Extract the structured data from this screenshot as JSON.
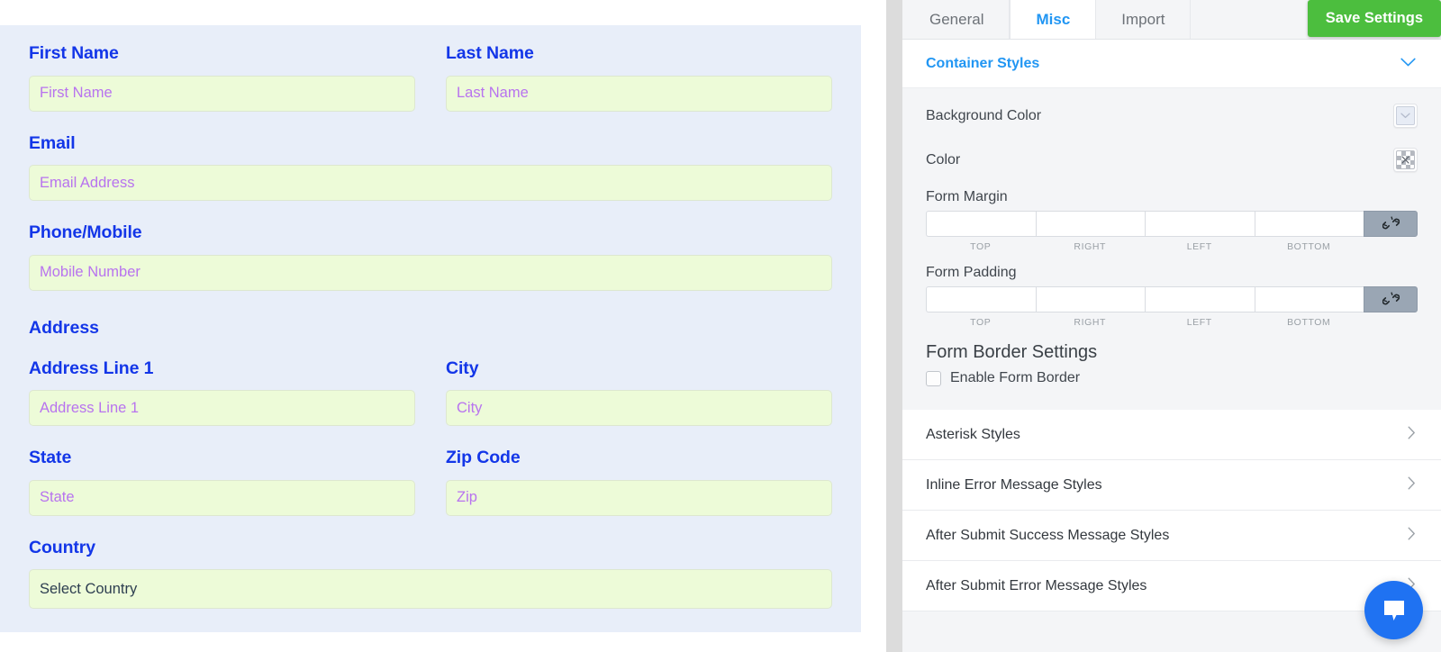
{
  "form_preview": {
    "fields": [
      {
        "label": "First Name",
        "placeholder": "First Name"
      },
      {
        "label": "Last Name",
        "placeholder": "Last Name"
      },
      {
        "label": "Email",
        "placeholder": "Email Address"
      },
      {
        "label": "Phone/Mobile",
        "placeholder": "Mobile Number"
      }
    ],
    "address_group_heading": "Address",
    "address_fields": [
      {
        "label": "Address Line 1",
        "placeholder": "Address Line 1"
      },
      {
        "label": "City",
        "placeholder": "City"
      },
      {
        "label": "State",
        "placeholder": "State"
      },
      {
        "label": "Zip Code",
        "placeholder": "Zip"
      }
    ],
    "country": {
      "label": "Country",
      "selected": "Select Country"
    },
    "colors": {
      "card_background": "#e8eef9",
      "label_color": "#1336e8",
      "input_background": "#edfbd8",
      "placeholder_color": "#b873ef"
    }
  },
  "settings": {
    "tabs": [
      {
        "label": "General",
        "active": false
      },
      {
        "label": "Misc",
        "active": true
      },
      {
        "label": "Import",
        "active": false
      }
    ],
    "save_button": "Save Settings",
    "save_button_color": "#4cbe3e",
    "accent_color": "#2196f3",
    "container_styles": {
      "title": "Container Styles",
      "chevron": "chevron-down",
      "options": [
        {
          "label": "Background Color",
          "swatch": "light-blue"
        },
        {
          "label": "Color",
          "swatch": "transparent-checker"
        }
      ],
      "spacing": [
        {
          "label": "Form Margin",
          "values": [
            "",
            "",
            "",
            ""
          ],
          "sides": [
            "TOP",
            "RIGHT",
            "LEFT",
            "BOTTOM"
          ],
          "link_icon": "unlink-icon"
        },
        {
          "label": "Form Padding",
          "values": [
            "",
            "",
            "",
            ""
          ],
          "sides": [
            "TOP",
            "RIGHT",
            "LEFT",
            "BOTTOM"
          ],
          "link_icon": "unlink-icon"
        }
      ],
      "border_settings": {
        "heading": "Form Border Settings",
        "checkbox_label": "Enable Form Border",
        "checked": false
      }
    },
    "style_sections": [
      {
        "label": "Asterisk Styles"
      },
      {
        "label": "Inline Error Message Styles"
      },
      {
        "label": "After Submit Success Message Styles"
      },
      {
        "label": "After Submit Error Message Styles"
      }
    ]
  },
  "chat_widget": {
    "icon": "chat-bubble-icon",
    "color": "#1f72f2"
  }
}
